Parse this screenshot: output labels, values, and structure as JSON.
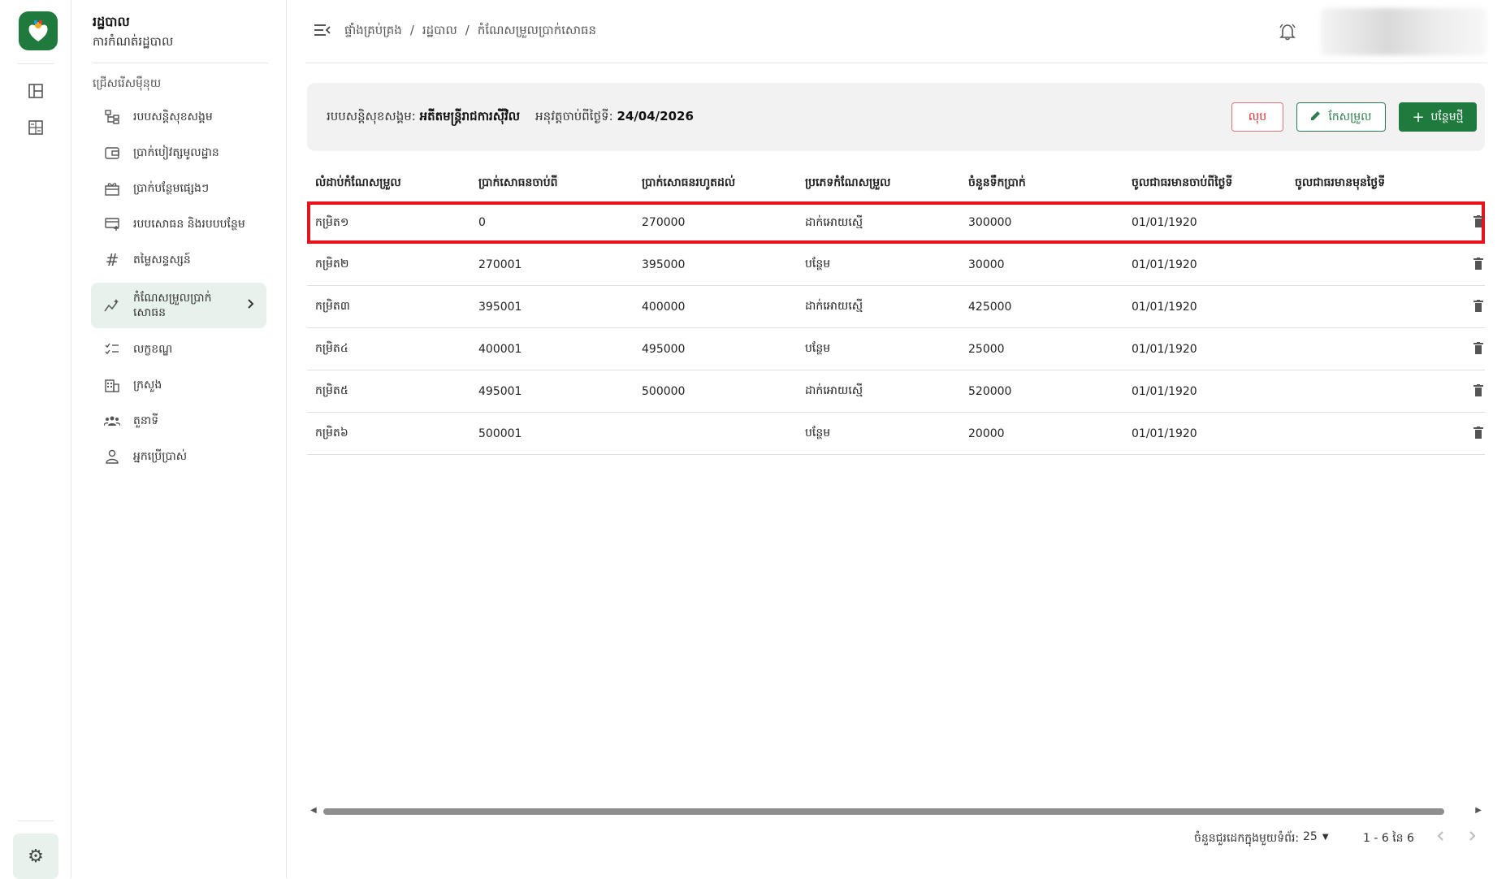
{
  "colors": {
    "primary": "#1f7a3e",
    "danger": "#d32f2f",
    "highlight": "#e5131a",
    "active_bg": "#e8f2ec"
  },
  "rail": {
    "icons": [
      "layout-icon",
      "calculator-icon"
    ],
    "settings_icon": "gear-icon"
  },
  "sidebar": {
    "title": "រដ្ឋបាល",
    "subtitle": "ការកំណត់រដ្ឋបាល",
    "section_label": "ជ្រើសរើសម៉ឺនុយ",
    "items": [
      {
        "label": "របបសន្តិសុខសង្គម",
        "icon": "hierarchy-icon"
      },
      {
        "label": "ប្រាក់បៀវត្សមូលដ្ឋាន",
        "icon": "wallet-icon"
      },
      {
        "label": "ប្រាក់បន្ថែមផ្សេងៗ",
        "icon": "gift-icon"
      },
      {
        "label": "របបសោធន និងរបបបន្ថែម",
        "icon": "card-add-icon"
      },
      {
        "label": "តម្លៃសន្ទស្សន៍",
        "icon": "hash-icon"
      },
      {
        "label": "កំណែសម្រួលប្រាក់សោធន",
        "icon": "chart-sparkle-icon",
        "active": true
      },
      {
        "label": "លក្ខខណ្ឌ",
        "icon": "checklist-icon"
      },
      {
        "label": "ក្រសួង",
        "icon": "building-icon"
      },
      {
        "label": "តួនាទី",
        "icon": "group-icon"
      },
      {
        "label": "អ្នកប្រើប្រាស់",
        "icon": "person-icon"
      }
    ]
  },
  "header": {
    "breadcrumb": [
      "ផ្ទាំងគ្រប់គ្រង",
      "/",
      "រដ្ឋបាល",
      "/",
      "កំណែសម្រួលប្រាក់សោធន"
    ],
    "menu_icon": "menu-collapse-icon",
    "bell_icon": "bell-icon"
  },
  "info": {
    "scheme_label": "របបសន្តិសុខសង្គម:",
    "scheme_value": "អតីតមន្ត្រីរាជការស៊ីវិល",
    "date_label": "អនុវត្តចាប់ពីថ្ងៃទី:",
    "date_value": "24/04/2026",
    "delete_label": "លុប",
    "edit_label": "កែសម្រួល",
    "add_label": "បន្ថែមថ្មី"
  },
  "table": {
    "headers": [
      "លំដាប់កំណែសម្រួល",
      "ប្រាក់សោធនចាប់ពី",
      "ប្រាក់សោធនរហូតដល់",
      "ប្រភេទកំណែសម្រួល",
      "ចំនួនទឹកប្រាក់",
      "ចូលជាធរមានចាប់ពីថ្ងៃទី",
      "ចូលជាធរមានមុនថ្ងៃទី"
    ],
    "rows": [
      [
        "កម្រិត១",
        "0",
        "270000",
        "ដាក់អោយស្មើ",
        "300000",
        "01/01/1920",
        ""
      ],
      [
        "កម្រិត២",
        "270001",
        "395000",
        "បន្ថែម",
        "30000",
        "01/01/1920",
        ""
      ],
      [
        "កម្រិត៣",
        "395001",
        "400000",
        "ដាក់អោយស្មើ",
        "425000",
        "01/01/1920",
        ""
      ],
      [
        "កម្រិត៤",
        "400001",
        "495000",
        "បន្ថែម",
        "25000",
        "01/01/1920",
        ""
      ],
      [
        "កម្រិត៥",
        "495001",
        "500000",
        "ដាក់អោយស្មើ",
        "520000",
        "01/01/1920",
        ""
      ],
      [
        "កម្រិត៦",
        "500001",
        "",
        "បន្ថែម",
        "20000",
        "01/01/1920",
        ""
      ]
    ]
  },
  "pagination": {
    "rows_label": "ចំនួនជួរដេកក្នុងមួយទំព័រ:",
    "page_size": "25",
    "range": "1 - 6 នៃ 6"
  }
}
